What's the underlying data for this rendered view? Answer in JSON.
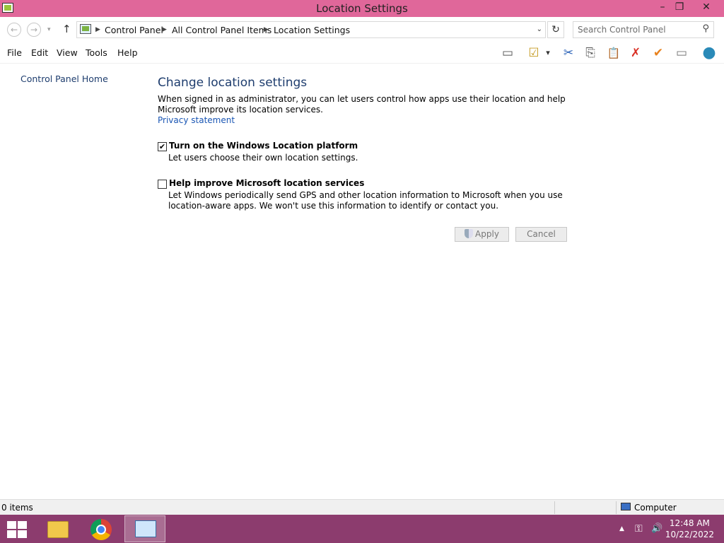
{
  "window": {
    "title": "Location Settings",
    "minimize": "–",
    "restore": "❐",
    "close": "✕"
  },
  "nav": {
    "back_icon": "←",
    "forward_icon": "→",
    "recent_icon": "▾",
    "up_icon": "↑",
    "breadcrumb": [
      "Control Panel",
      "All Control Panel Items",
      "Location Settings"
    ],
    "separator": "▶",
    "address_dropdown": "⌄",
    "refresh_icon": "↻",
    "search_placeholder": "Search Control Panel",
    "search_icon": "⚲"
  },
  "menu": [
    "File",
    "Edit",
    "View",
    "Tools",
    "Help"
  ],
  "toolbar": {
    "preview_pane": "▭",
    "properties": "☑",
    "dropdown": "▾",
    "cut": "✂",
    "copy": "⎘",
    "paste": "📋",
    "delete": "✗",
    "check": "✔",
    "rename": "▭",
    "internet": "●"
  },
  "left_pane": {
    "home_link": "Control Panel Home"
  },
  "content": {
    "heading": "Change location settings",
    "description": "When signed in as administrator, you can let users control how apps use their location and help Microsoft improve its location services.",
    "privacy_link": "Privacy statement",
    "options": [
      {
        "checked": true,
        "check_mark": "✔",
        "title": "Turn on the Windows Location platform",
        "desc": "Let users choose their own location settings."
      },
      {
        "checked": false,
        "check_mark": "",
        "title": "Help improve Microsoft location services",
        "desc": "Let Windows periodically send GPS and other location information to Microsoft when you use location-aware apps. We won't use this information to identify or contact you."
      }
    ],
    "apply_label": "Apply",
    "cancel_label": "Cancel"
  },
  "status": {
    "item_count": "0 items",
    "zone": "Computer"
  },
  "taskbar": {
    "tray_arrow": "▲",
    "network_icon": "⚿",
    "volume_icon": "🔊",
    "time": "12:48 AM",
    "date": "10/22/2022"
  },
  "colors": {
    "titlebar": "#e0679a",
    "taskbar": "#8c3c6e",
    "link": "#1a56b4",
    "heading": "#1e3d6e"
  }
}
